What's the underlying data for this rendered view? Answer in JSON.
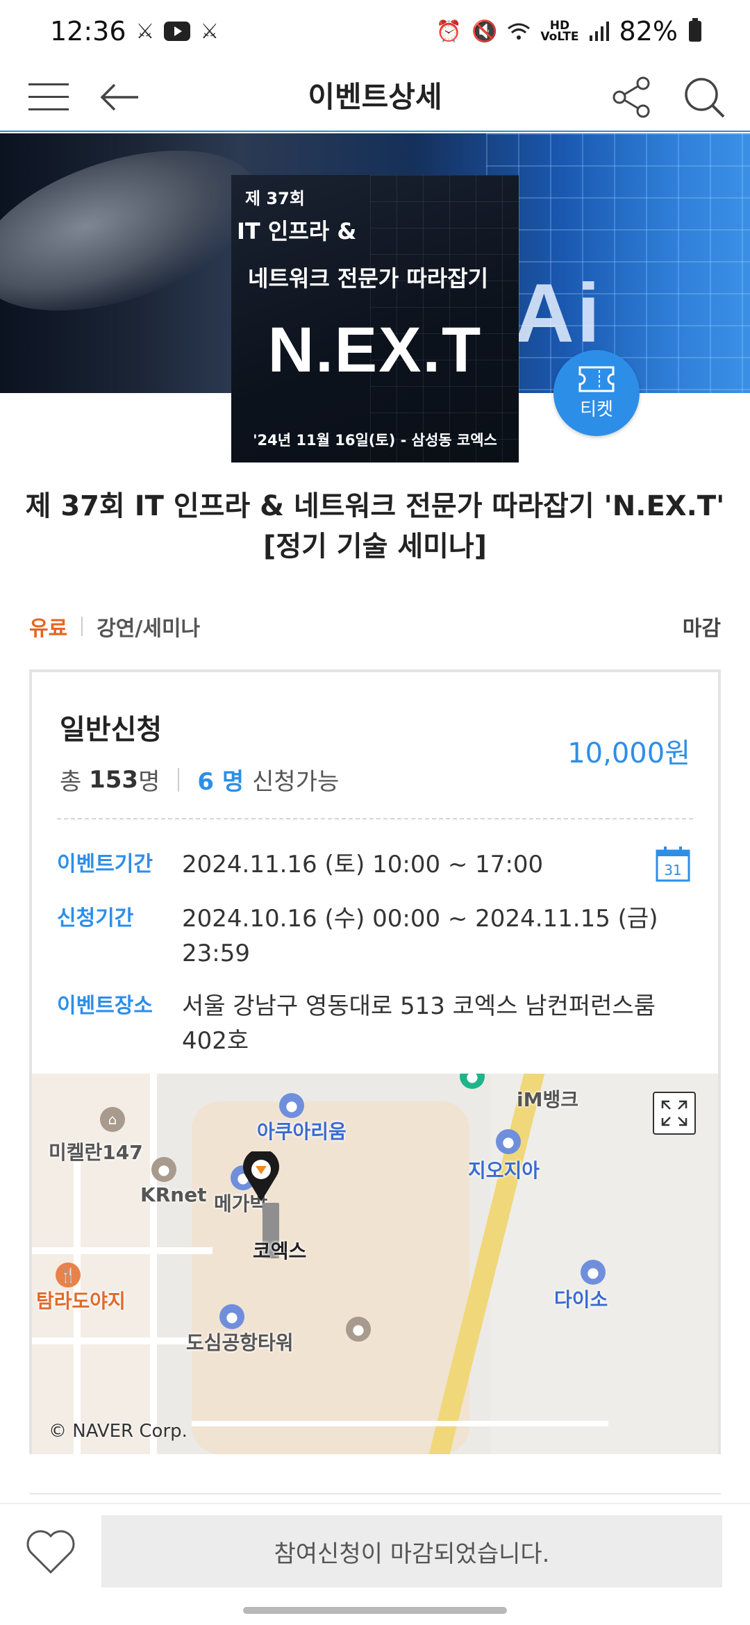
{
  "status_bar": {
    "time": "12:36",
    "battery": "82%",
    "hd_label": "HD\nVoice"
  },
  "header": {
    "title": "이벤트상세"
  },
  "banner": {
    "ai_text": "Ai",
    "poster": {
      "edition": "제 37회",
      "line1": "IT 인프라 &",
      "line2": "네트워크 전문가 따라잡기",
      "main": "N.EX.T",
      "date": "'24년 11월 16일(토) - 삼성동 코엑스"
    },
    "ticket_label": "티켓"
  },
  "event": {
    "title_line1": "제 37회 IT 인프라 & 네트워크 전문가 따라잡기 'N.EX.T'",
    "title_line2": "[정기 기술 세미나]",
    "fee_type": "유료",
    "category": "강연/세미나",
    "status": "마감"
  },
  "registration": {
    "type": "일반신청",
    "total_prefix": "총",
    "total_count": "153",
    "total_suffix": "명",
    "available_count": "6 명",
    "available_suffix": "신청가능",
    "price": "10,000원"
  },
  "details": {
    "event_period_label": "이벤트기간",
    "event_period": "2024.11.16 (토) 10:00 ~ 17:00",
    "apply_period_label": "신청기간",
    "apply_period_line1": "2024.10.16 (수) 00:00 ~ 2024.11.15 (금)",
    "apply_period_line2": "23:59",
    "location_label": "이벤트장소",
    "location_line1": "서울 강남구 영동대로 513 코엑스 남컨퍼런스룸",
    "location_line2": "402호",
    "calendar_day": "31"
  },
  "map": {
    "labels": {
      "imbank": "iM뱅크",
      "aquarium": "아쿠아리움",
      "michelan": "미켈란147",
      "giordano": "지오지아",
      "krnet": "KRnet",
      "megabox": "메가박",
      "coex": "코엑스",
      "tamra": "탐라도야지",
      "daiso": "다이소",
      "dosim": "도심공항타워"
    },
    "copyright": "© NAVER Corp."
  },
  "bottom": {
    "apply_label": "참여신청이 마감되었습니다."
  },
  "colors": {
    "accent": "#2d8ee8",
    "paid": "#e8641e",
    "header_line": "#2f8ad9"
  }
}
